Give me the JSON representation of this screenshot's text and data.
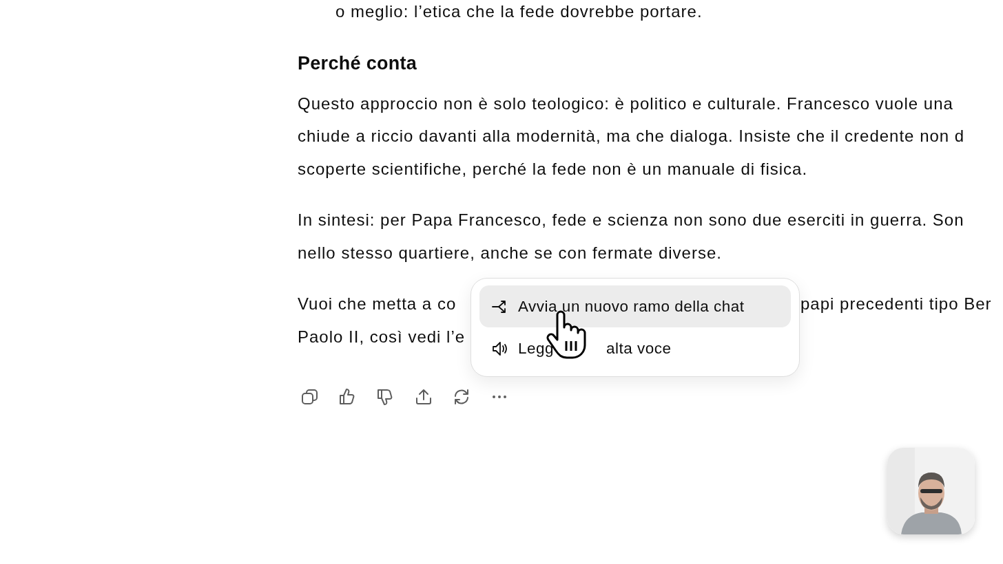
{
  "response": {
    "list_continuation": "o meglio: l’etica che la fede dovrebbe portare.",
    "heading": "Perché conta",
    "paragraphs": [
      {
        "lines": [
          {
            "segments": [
              "Questo approccio non è solo teologico: è politico e culturale. Francesco vuole una"
            ]
          },
          {
            "segments": [
              "chiude a riccio davanti alla modernità, ma che dialoga. Insiste che il credente non d"
            ]
          },
          {
            "segments": [
              "scoperte scientifiche, perché la fede non è un manuale di fisica."
            ]
          }
        ]
      },
      {
        "lines": [
          {
            "segments": [
              "In sintesi: per Papa Francesco, fede e scienza non sono due eserciti in guerra. Son"
            ]
          },
          {
            "segments": [
              "nello stesso quartiere, anche se con fermate diverse."
            ]
          }
        ]
      },
      {
        "lines": [
          {
            "segments": [
              "Vuoi che metta a co",
              "papi precedenti tipo Ber"
            ]
          },
          {
            "segments": [
              "Paolo II, così vedi l’e"
            ]
          }
        ]
      }
    ]
  },
  "actions": [
    {
      "kind": "copy"
    },
    {
      "kind": "thumbs-up"
    },
    {
      "kind": "thumbs-down"
    },
    {
      "kind": "share"
    },
    {
      "kind": "regenerate"
    },
    {
      "kind": "more"
    }
  ],
  "menu": {
    "items": [
      {
        "kind": "branch",
        "selected": true,
        "segments": [
          "Avvia un nuovo ramo della chat"
        ]
      },
      {
        "kind": "speaker",
        "selected": false,
        "segments": [
          "Legg",
          "alta voce"
        ]
      }
    ]
  }
}
